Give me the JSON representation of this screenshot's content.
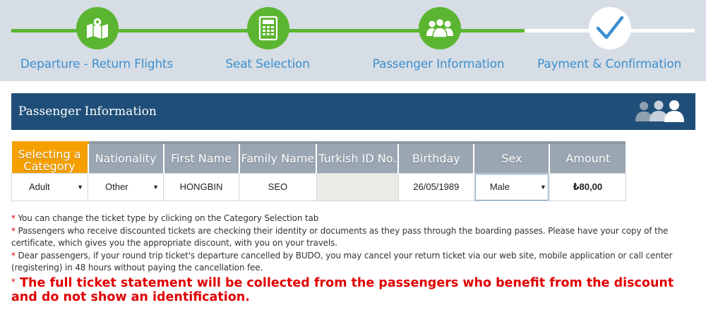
{
  "steps": [
    {
      "label": "Departure - Return Flights",
      "icon": "map-pin-icon",
      "state": "done"
    },
    {
      "label": "Seat Selection",
      "icon": "seat-grid-icon",
      "state": "done"
    },
    {
      "label": "Passenger Information",
      "icon": "passengers-icon",
      "state": "active"
    },
    {
      "label": "Payment & Confirmation",
      "icon": "checkmark-icon",
      "state": "pending"
    }
  ],
  "panel": {
    "title": "Passenger Information",
    "icon": "passengers-icon"
  },
  "table": {
    "headers": [
      "Selecting a Category",
      "Nationality",
      "First Name",
      "Family Name",
      "Turkish ID No.",
      "Birthday",
      "Sex",
      "Amount"
    ],
    "row": {
      "category": "Adult",
      "nationality": "Other",
      "first_name": "HONGBIN",
      "family_name": "SEO",
      "turkish_id": "",
      "birthday": "26/05/1989",
      "sex": "Male",
      "amount": "₺80,00"
    }
  },
  "notes": [
    "You can change the ticket type by clicking on the Category Selection tab",
    "Passengers who receive discounted tickets are checking their identity or documents as they pass through the boarding passes. Please have your copy of the certificate, which gives you the appropriate discount, with you on your travels.",
    "Dear passengers, if your round trip ticket's departure cancelled by BUDO, you may cancel your return ticket via our web site, mobile application or call center (registering) in 48 hours without paying the cancellation fee."
  ],
  "warning": "The full ticket statement will be collected from the passengers who benefit from the discount and do not show an identification.",
  "colors": {
    "step_green": "#5bb531",
    "label_blue": "#3d8fd0",
    "header_navy": "#1f4f78",
    "active_orange": "#f5a000",
    "warning_red": "#e00000"
  }
}
